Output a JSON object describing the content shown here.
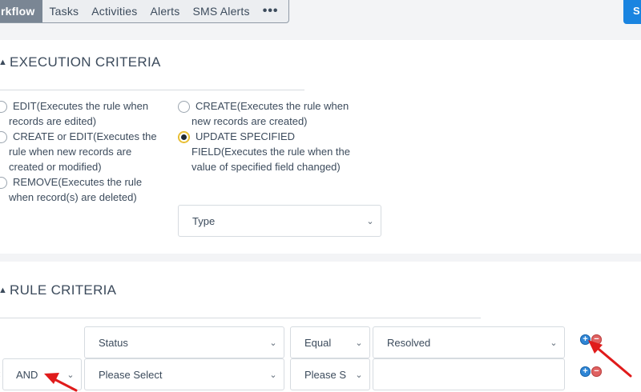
{
  "tabs": [
    {
      "label": "rkflow",
      "active": true
    },
    {
      "label": "Tasks",
      "active": false
    },
    {
      "label": "Activities",
      "active": false
    },
    {
      "label": "Alerts",
      "active": false
    },
    {
      "label": "SMS Alerts",
      "active": false
    },
    {
      "label": "•••",
      "active": false
    }
  ],
  "header_button": {
    "label": "S",
    "color": "#1a84e0"
  },
  "execution": {
    "title": "EXECUTION CRITERIA",
    "options": {
      "edit": {
        "line1": "EDIT(Executes the rule when",
        "line2": "records are edited)",
        "checked": false
      },
      "create_or_edit": {
        "line1": "CREATE or EDIT(Executes the",
        "line2": "rule when new records are",
        "line3": "created or modified)",
        "checked": false
      },
      "remove": {
        "line1": "REMOVE(Executes the rule",
        "line2": "when record(s) are deleted)",
        "checked": false
      },
      "create": {
        "line1": "CREATE(Executes the rule when",
        "line2": "new records are created)",
        "checked": false
      },
      "update_field": {
        "line1": "UPDATE SPECIFIED",
        "line2": "FIELD(Executes the rule when the",
        "line3": "value of specified field changed)",
        "checked": true
      }
    },
    "type_select": {
      "value": "Type"
    }
  },
  "rule": {
    "title": "RULE CRITERIA",
    "rows": [
      {
        "field": "Status",
        "operator": "Equal",
        "value": "Resolved"
      },
      {
        "connector": "AND",
        "field": "Please Select",
        "operator": "Please S",
        "value": ""
      }
    ]
  },
  "colors": {
    "accent_blue": "#1a84e0",
    "active_tab": "#7a8694",
    "radio_selected_ring": "#e0b21f",
    "annotation_arrow": "#e01b1b",
    "plus": "#2f86d6",
    "minus": "#e06262"
  },
  "icons": {
    "section_caret": "caret-up-icon",
    "select_chevron": "chevron-down-icon",
    "add_condition": "plus-circle-icon",
    "remove_condition": "minus-circle-icon",
    "annotation": "red-arrow-icon"
  }
}
